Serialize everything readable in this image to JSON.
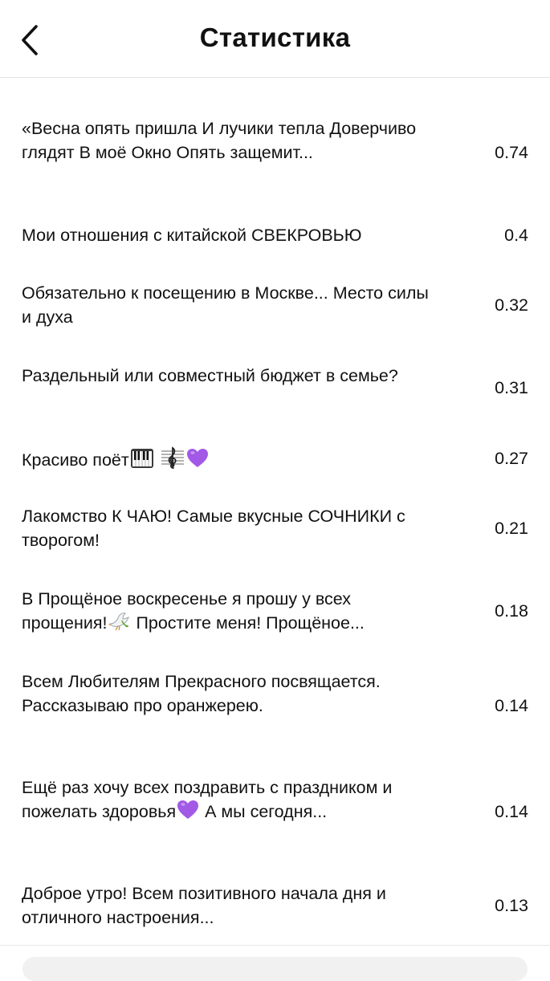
{
  "header": {
    "title": "Статистика",
    "back_icon": "chevron-left-icon"
  },
  "rows": [
    {
      "title": "«Весна опять пришла И лучики тепла Доверчиво глядят В моё Окно Опять защемит...",
      "value": "0.74"
    },
    {
      "title": "Мои отношения с китайской СВЕКРОВЬЮ",
      "value": "0.4"
    },
    {
      "title": "Обязательно к посещению в Москве... Место силы и духа",
      "value": "0.32"
    },
    {
      "title": "Раздельный или совместный бюджет в семье?",
      "value": "0.31"
    },
    {
      "title": "Красиво поёт",
      "value": "0.27",
      "emojis": [
        "piano-icon",
        "treble-clef-icon",
        "purple-heart-icon"
      ]
    },
    {
      "title": "Лакомство К ЧАЮ! Самые вкусные СОЧНИКИ с творогом!",
      "value": "0.21"
    },
    {
      "title_part1": "В Прощёное воскресенье я прошу у всех прощения!",
      "title_part2": " Простите меня! Прощёное...",
      "value": "0.18",
      "emojis": [
        "dove-icon"
      ]
    },
    {
      "title": "Всем Любителям Прекрасного посвящается. Рассказываю про оранжерею.",
      "value": "0.14"
    },
    {
      "title_part1": "Ещё раз хочу всех поздравить с праздником и пожелать здоровья",
      "title_part2": " А мы сегодня...",
      "value": "0.14",
      "emojis": [
        "purple-heart-icon"
      ]
    },
    {
      "title": "Доброе утро! Всем позитивного начала дня и отличного настроения...",
      "value": "0.13"
    }
  ],
  "colors": {
    "text": "#111111",
    "divider": "#e3e3e3",
    "purple_heart": "#a259e6"
  }
}
